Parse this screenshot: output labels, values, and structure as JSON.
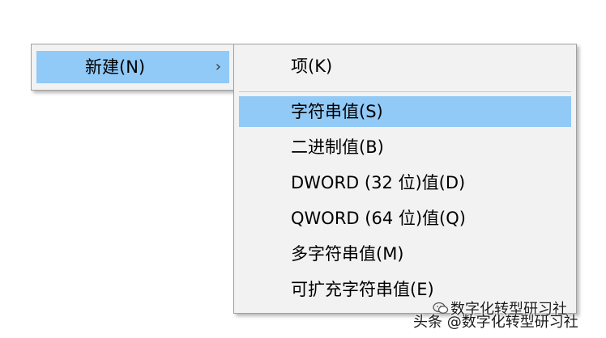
{
  "parent_menu": {
    "items": [
      {
        "label": "新建(N)",
        "chevron": "›",
        "icon": "chevron-right-icon"
      }
    ]
  },
  "sub_menu": {
    "items": [
      {
        "label": "项(K)"
      },
      {
        "label": "字符串值(S)"
      },
      {
        "label": "二进制值(B)"
      },
      {
        "label": "DWORD (32 位)值(D)"
      },
      {
        "label": "QWORD (64 位)值(Q)"
      },
      {
        "label": "多字符串值(M)"
      },
      {
        "label": "可扩充字符串值(E)"
      }
    ],
    "highlighted_index": 1
  },
  "watermark": {
    "line1": "数字化转型研习社",
    "line2": "头条 @数字化转型研习社",
    "icon": "wechat-icon"
  },
  "colors": {
    "highlight": "#91c9f7",
    "menu_background": "#f2f2f2",
    "menu_border": "#a0a0a0"
  }
}
